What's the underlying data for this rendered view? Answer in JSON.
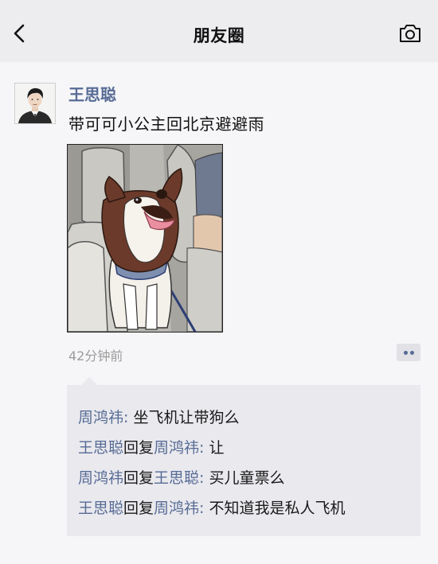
{
  "header": {
    "title": "朋友圈"
  },
  "post": {
    "author": "王思聪",
    "text": "带可可小公主回北京避避雨",
    "time": "42分钟前"
  },
  "comments": [
    {
      "from": "周鸿祎",
      "reply_word": "",
      "to": "",
      "separator": ": ",
      "text": "坐飞机让带狗么"
    },
    {
      "from": "王思聪",
      "reply_word": "回复",
      "to": "周鸿祎",
      "separator": ": ",
      "text": "让"
    },
    {
      "from": "周鸿祎",
      "reply_word": "回复",
      "to": "王思聪",
      "separator": ": ",
      "text": "买儿童票么"
    },
    {
      "from": "王思聪",
      "reply_word": "回复",
      "to": "周鸿祎",
      "separator": ": ",
      "text": "不知道我是私人飞机"
    }
  ],
  "icons": {
    "back": "chevron-left-icon",
    "camera": "camera-icon",
    "more": "more-dots-icon"
  },
  "colors": {
    "link": "#576b95",
    "header_bg": "#ededef",
    "comment_bg": "#e9e9ee",
    "time_text": "#9b9b9b"
  }
}
